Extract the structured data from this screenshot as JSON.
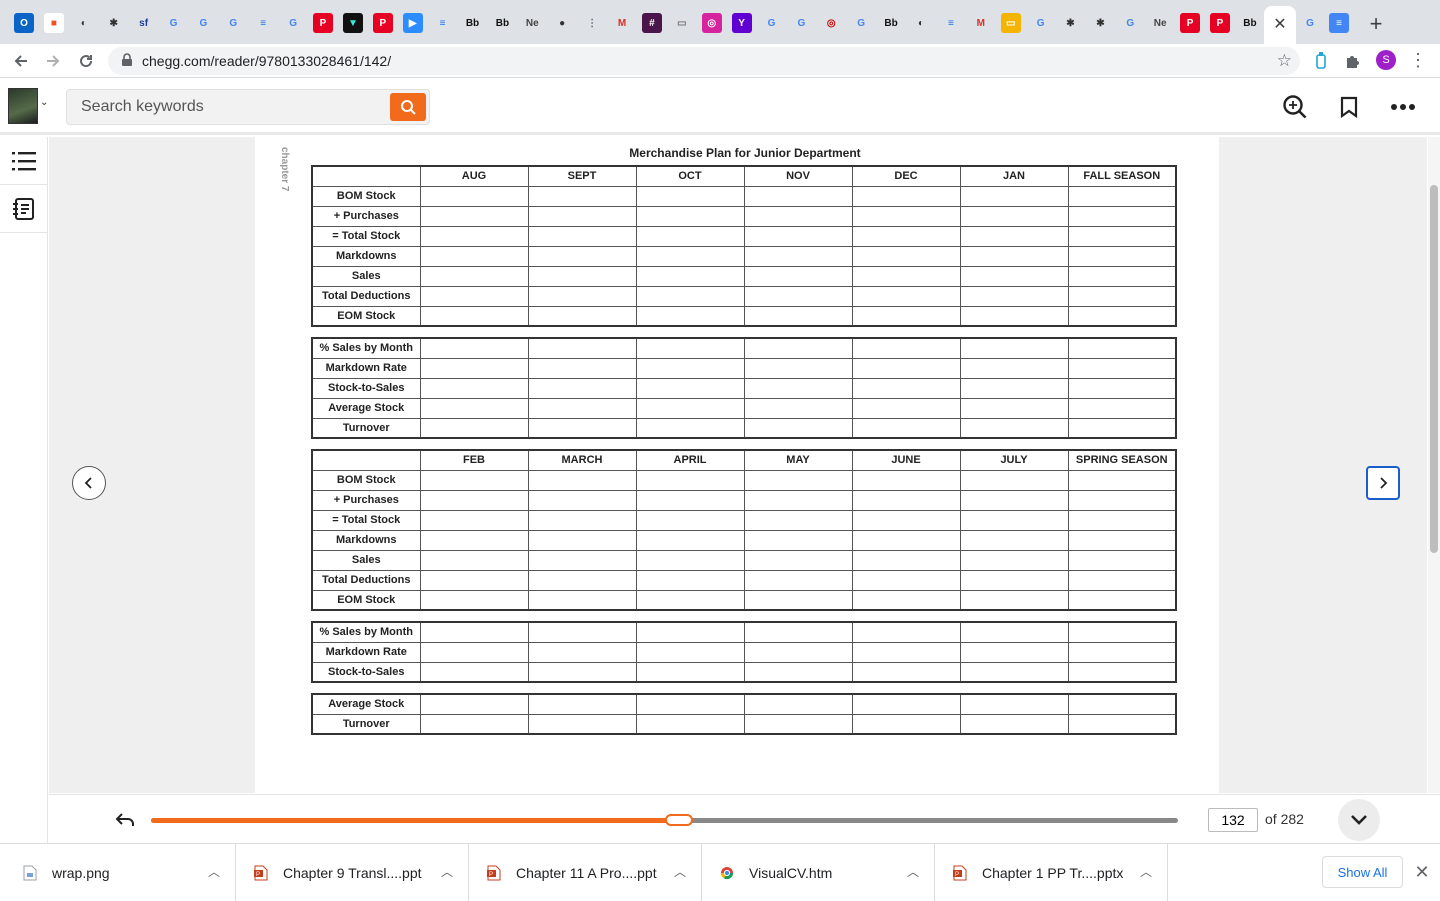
{
  "browser": {
    "tab_icons": [
      "outlook-icon",
      "microsoft-icon",
      "globe-icon",
      "figure-icon",
      "sf-icon",
      "google-icon",
      "google-icon",
      "google-icon",
      "filter-icon",
      "google-icon",
      "pinterest-icon",
      "bookmark-icon",
      "pinterest-icon",
      "zoom-icon",
      "filter-icon",
      "bb-icon",
      "bb-icon",
      "ne-icon",
      "circle-icon",
      "chart-icon",
      "gmail-icon",
      "slack-icon",
      "page-icon",
      "instagram-icon",
      "yahoo-icon",
      "google-icon",
      "google-icon",
      "target-icon",
      "google-icon",
      "bb-icon",
      "globe-icon",
      "filter-icon",
      "gmail-icon",
      "slides-icon",
      "google-icon",
      "figure-icon",
      "figure-icon",
      "google-icon",
      "ne-icon",
      "pinterest-icon",
      "pinterest-icon",
      "bb-icon"
    ],
    "active_tab_close": "✕",
    "after_tabs": [
      "google-icon",
      "docs-icon"
    ],
    "new_tab": "+",
    "url": "chegg.com/reader/9780133028461/142/",
    "profile_initial": "S"
  },
  "header": {
    "search_placeholder": "Search keywords"
  },
  "page": {
    "chapter_label": "chapter 7",
    "title": "Merchandise Plan for Junior Department",
    "fall": {
      "columns": [
        "AUG",
        "SEPT",
        "OCT",
        "NOV",
        "DEC",
        "JAN",
        "FALL SEASON"
      ],
      "stock_rows": [
        "BOM Stock",
        "+ Purchases",
        "= Total Stock",
        "Markdowns",
        "Sales",
        "Total Deductions",
        "EOM Stock"
      ],
      "ratio_rows": [
        "% Sales by Month",
        "Markdown Rate",
        "Stock-to-Sales",
        "Average Stock",
        "Turnover"
      ]
    },
    "spring": {
      "columns": [
        "FEB",
        "MARCH",
        "APRIL",
        "MAY",
        "JUNE",
        "JULY",
        "SPRING SEASON"
      ],
      "stock_rows": [
        "BOM Stock",
        "+ Purchases",
        "= Total Stock",
        "Markdowns",
        "Sales",
        "Total Deductions",
        "EOM Stock"
      ],
      "ratio_rows": [
        "% Sales by Month",
        "Markdown Rate",
        "Stock-to-Sales"
      ],
      "avg_rows": [
        "Average Stock",
        "Turnover"
      ]
    }
  },
  "navigation": {
    "current_page": "132",
    "total_label": "of 282",
    "progress_fraction": 0.52
  },
  "downloads": {
    "items": [
      {
        "name": "wrap.png",
        "icon": "image-file-icon"
      },
      {
        "name": "Chapter 9 Transl....ppt",
        "icon": "ppt-file-icon"
      },
      {
        "name": "Chapter 11 A Pro....ppt",
        "icon": "ppt-file-icon"
      },
      {
        "name": "VisualCV.htm",
        "icon": "chrome-file-icon"
      },
      {
        "name": "Chapter 1  PP Tr....pptx",
        "icon": "ppt-file-icon"
      }
    ],
    "show_all": "Show All"
  },
  "colors": {
    "accent": "#f26a1b",
    "link": "#1a73e8"
  }
}
